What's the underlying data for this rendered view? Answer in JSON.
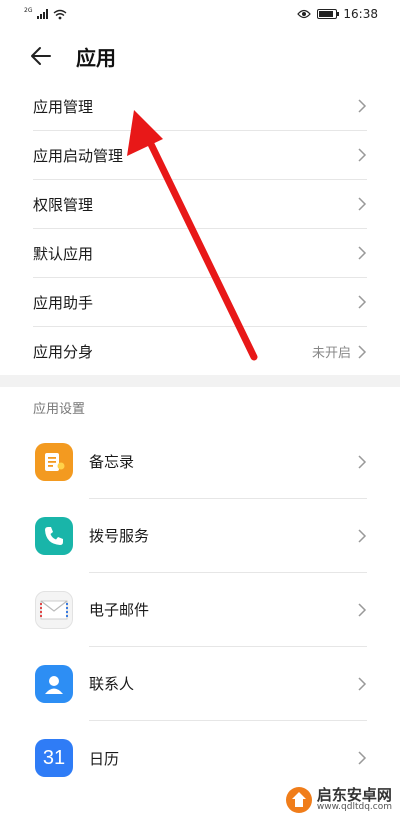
{
  "status": {
    "network": "2G",
    "time": "16:38",
    "battery_level": 0.85
  },
  "header": {
    "title": "应用"
  },
  "menu": [
    {
      "label": "应用管理",
      "value": ""
    },
    {
      "label": "应用启动管理",
      "value": ""
    },
    {
      "label": "权限管理",
      "value": ""
    },
    {
      "label": "默认应用",
      "value": ""
    },
    {
      "label": "应用助手",
      "value": ""
    },
    {
      "label": "应用分身",
      "value": "未开启"
    }
  ],
  "section": {
    "title": "应用设置"
  },
  "apps": [
    {
      "label": "备忘录",
      "icon": "notepad-icon",
      "color": "#f39a20"
    },
    {
      "label": "拨号服务",
      "icon": "phone-icon",
      "color": "#19b5a9"
    },
    {
      "label": "电子邮件",
      "icon": "mail-icon",
      "color": "#eeeeee"
    },
    {
      "label": "联系人",
      "icon": "contacts-icon",
      "color": "#2d8ef4"
    },
    {
      "label": "日历",
      "icon": "calendar-icon",
      "color": "#2f7cf6",
      "number": "31"
    }
  ],
  "annotation": {
    "color": "#e81818"
  },
  "watermark": {
    "name": "启东安卓网",
    "url": "www.qdltdq.com"
  }
}
